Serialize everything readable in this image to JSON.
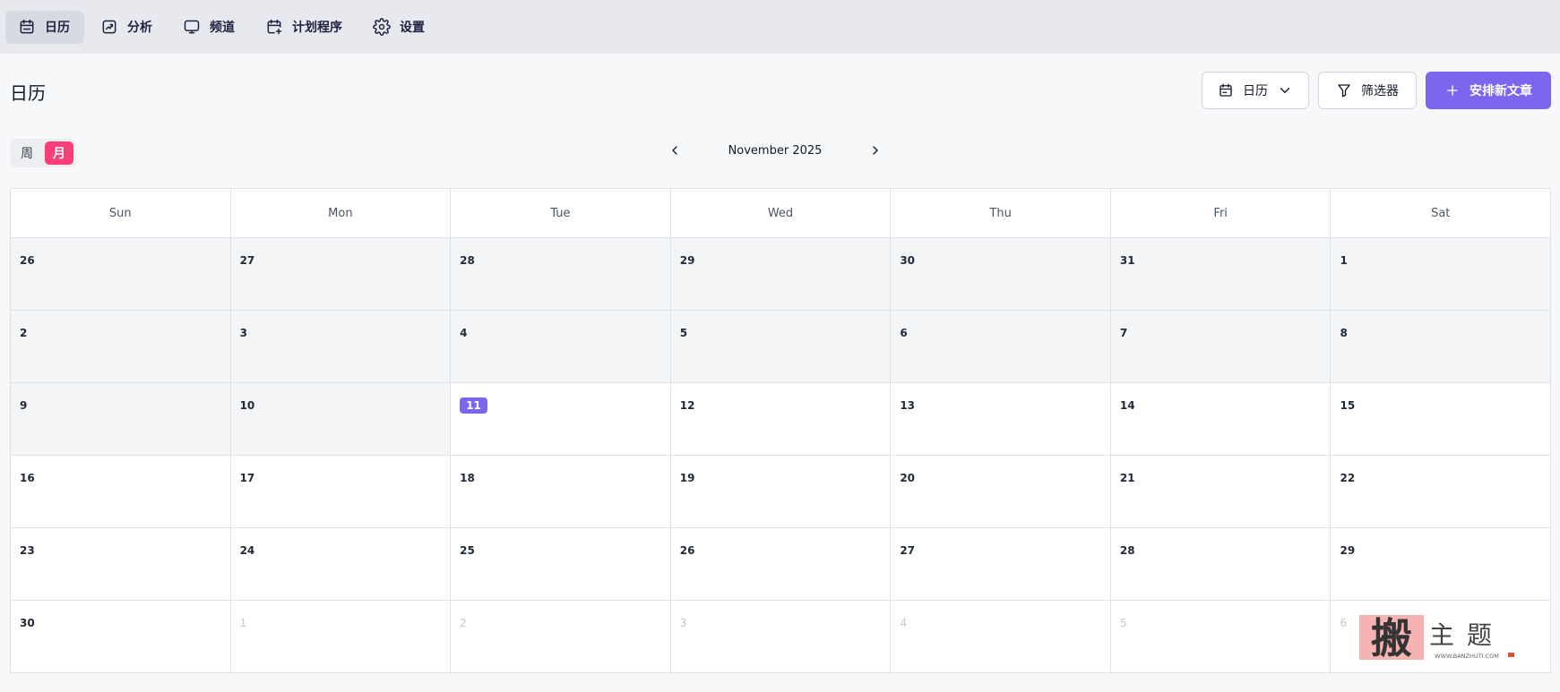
{
  "nav": [
    {
      "label": "日历",
      "icon": "calendar-icon",
      "active": true
    },
    {
      "label": "分析",
      "icon": "chart-icon",
      "active": false
    },
    {
      "label": "频道",
      "icon": "monitor-icon",
      "active": false
    },
    {
      "label": "计划程序",
      "icon": "calendar-plus-icon",
      "active": false
    },
    {
      "label": "设置",
      "icon": "gear-icon",
      "active": false
    }
  ],
  "header": {
    "title": "日历",
    "view_label": "日历",
    "filter_label": "筛选器",
    "new_label": "安排新文章"
  },
  "toggle": {
    "week": "周",
    "month": "月",
    "active": "month"
  },
  "month_label": "November 2025",
  "weekdays": [
    "Sun",
    "Mon",
    "Tue",
    "Wed",
    "Thu",
    "Fri",
    "Sat"
  ],
  "weeks": [
    [
      {
        "d": "26",
        "t": "past"
      },
      {
        "d": "27",
        "t": "past"
      },
      {
        "d": "28",
        "t": "past"
      },
      {
        "d": "29",
        "t": "past"
      },
      {
        "d": "30",
        "t": "past"
      },
      {
        "d": "31",
        "t": "past"
      },
      {
        "d": "1",
        "t": "past"
      }
    ],
    [
      {
        "d": "2",
        "t": "past"
      },
      {
        "d": "3",
        "t": "past"
      },
      {
        "d": "4",
        "t": "past"
      },
      {
        "d": "5",
        "t": "past"
      },
      {
        "d": "6",
        "t": "past"
      },
      {
        "d": "7",
        "t": "past"
      },
      {
        "d": "8",
        "t": "past"
      }
    ],
    [
      {
        "d": "9",
        "t": "past"
      },
      {
        "d": "10",
        "t": "past"
      },
      {
        "d": "11",
        "t": "today"
      },
      {
        "d": "12",
        "t": "normal"
      },
      {
        "d": "13",
        "t": "normal"
      },
      {
        "d": "14",
        "t": "normal"
      },
      {
        "d": "15",
        "t": "normal"
      }
    ],
    [
      {
        "d": "16",
        "t": "normal"
      },
      {
        "d": "17",
        "t": "normal"
      },
      {
        "d": "18",
        "t": "normal"
      },
      {
        "d": "19",
        "t": "normal"
      },
      {
        "d": "20",
        "t": "normal"
      },
      {
        "d": "21",
        "t": "normal"
      },
      {
        "d": "22",
        "t": "normal"
      }
    ],
    [
      {
        "d": "23",
        "t": "normal"
      },
      {
        "d": "24",
        "t": "normal"
      },
      {
        "d": "25",
        "t": "normal"
      },
      {
        "d": "26",
        "t": "normal"
      },
      {
        "d": "27",
        "t": "normal"
      },
      {
        "d": "28",
        "t": "normal"
      },
      {
        "d": "29",
        "t": "normal"
      }
    ],
    [
      {
        "d": "30",
        "t": "normal"
      },
      {
        "d": "1",
        "t": "other"
      },
      {
        "d": "2",
        "t": "other"
      },
      {
        "d": "3",
        "t": "other"
      },
      {
        "d": "4",
        "t": "other"
      },
      {
        "d": "5",
        "t": "other"
      },
      {
        "d": "6",
        "t": "other"
      }
    ]
  ],
  "watermark": {
    "big": "搬",
    "text": "主题",
    "url": "WWW.BANZHUTI.COM"
  },
  "colors": {
    "accent": "#7a67ee",
    "toggle_active": "#fb3f7a",
    "past_bg": "#f4f5f7"
  }
}
